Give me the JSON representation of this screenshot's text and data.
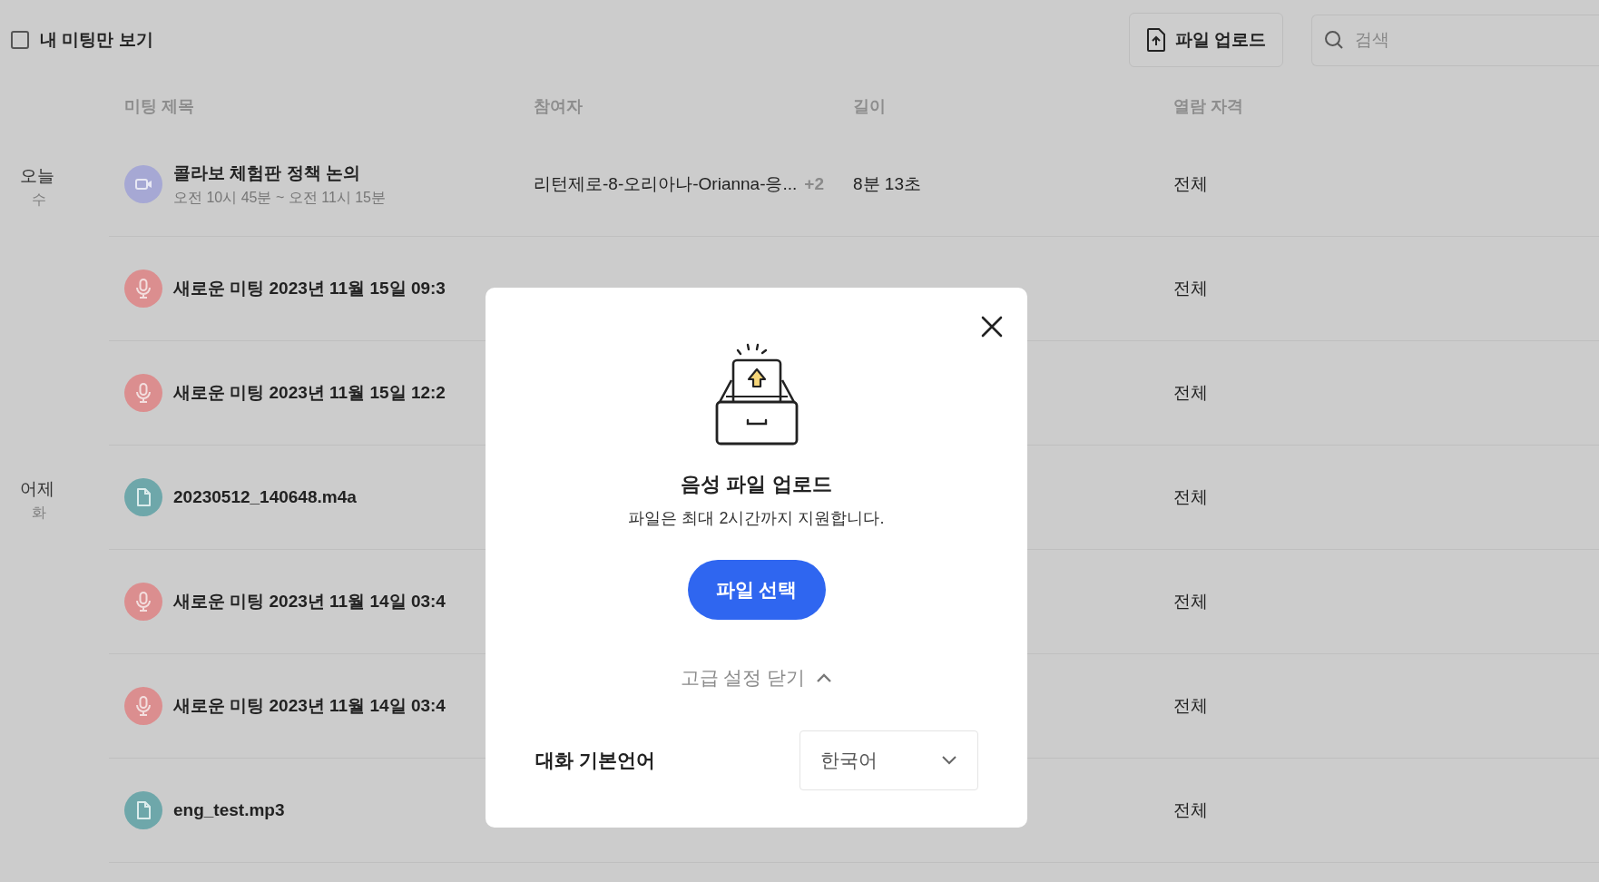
{
  "filter": {
    "label": "내 미팅만 보기",
    "checked": false
  },
  "upload_button": "파일 업로드",
  "search": {
    "placeholder": "검색"
  },
  "table": {
    "columns": [
      "미팅 제목",
      "참여자",
      "길이",
      "열람 자격"
    ],
    "groups": [
      {
        "day": "오늘",
        "weekday": "수",
        "rows": [
          {
            "kind": "video",
            "title": "콜라보 체험판 정책 논의",
            "time": "오전 10시 45분 ~ 오전 11시 15분",
            "participants": "리턴제로-8-오리아나-Orianna-응...",
            "extra": "+2",
            "duration": "8분 13초",
            "access": "전체"
          },
          {
            "kind": "mic",
            "title": "새로운 미팅 2023년 11월 15일 09:3",
            "access": "전체"
          },
          {
            "kind": "mic",
            "title": "새로운 미팅 2023년 11월 15일 12:2",
            "access": "전체"
          }
        ]
      },
      {
        "day": "어제",
        "weekday": "화",
        "rows": [
          {
            "kind": "file",
            "title": "20230512_140648.m4a",
            "access": "전체"
          },
          {
            "kind": "mic",
            "title": "새로운 미팅 2023년 11월 14일 03:4",
            "access": "전체"
          },
          {
            "kind": "mic",
            "title": "새로운 미팅 2023년 11월 14일 03:4",
            "access": "전체"
          },
          {
            "kind": "file",
            "title": "eng_test.mp3",
            "access": "전체"
          }
        ]
      }
    ]
  },
  "dialog": {
    "title": "음성 파일 업로드",
    "subtitle": "파일은 최대 2시간까지 지원합니다.",
    "primary_button": "파일 선택",
    "advanced_toggle": {
      "label": "고급 설정 닫기",
      "expanded": true
    },
    "language": {
      "label": "대화 기본언어",
      "value": "한국어"
    }
  }
}
